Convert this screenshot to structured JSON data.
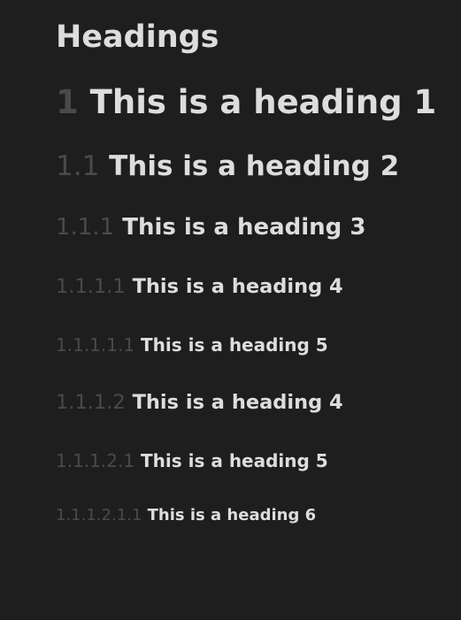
{
  "page": {
    "title": "Headings"
  },
  "headings": [
    {
      "number": "1",
      "text": "This is a heading 1"
    },
    {
      "number": "1.1",
      "text": "This is a heading 2"
    },
    {
      "number": "1.1.1",
      "text": "This is a heading 3"
    },
    {
      "number": "1.1.1.1",
      "text": "This is a heading 4"
    },
    {
      "number": "1.1.1.1.1",
      "text": "This is a heading 5"
    },
    {
      "number": "1.1.1.2",
      "text": "This is a heading 4"
    },
    {
      "number": "1.1.1.2.1",
      "text": "This is a heading 5"
    },
    {
      "number": "1.1.1.2.1.1",
      "text": "This is a heading 6"
    }
  ],
  "colors": {
    "background": "#1e1e1e",
    "text": "#dcddde",
    "number": "#4a4a4a"
  }
}
